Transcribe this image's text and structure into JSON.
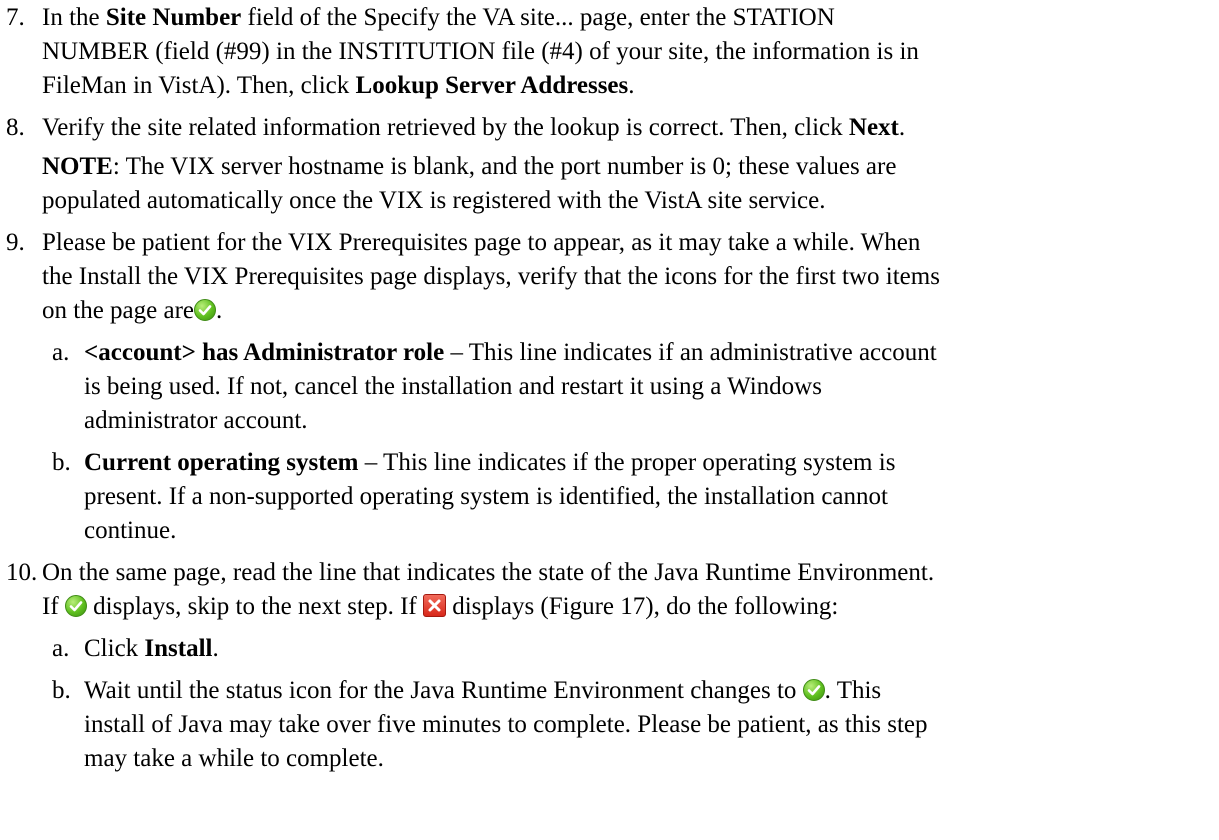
{
  "steps": {
    "s7": {
      "num": "7.",
      "l1_a": "In the ",
      "l1_b": "Site Number",
      "l1_c": " field of the Specify the VA site... page, enter the STATION",
      "l2": "NUMBER (field (#99) in the INSTITUTION file (#4) of your site, the information is in",
      "l3_a": "FileMan in VistA). Then, click ",
      "l3_b": "Lookup Server Addresses",
      "l3_c": "."
    },
    "s8": {
      "num": "8.",
      "l1_a": "Verify the site related information retrieved by the lookup is correct. Then, click ",
      "l1_b": "Next",
      "l1_c": ".",
      "note_label": "NOTE",
      "note_l1": ": The VIX server hostname is blank, and the port number is 0; these values are",
      "note_l2": "populated automatically once the VIX is registered with the VistA site service."
    },
    "s9": {
      "num": "9.",
      "l1": "Please be patient for the VIX Prerequisites page to appear, as it may take a while. When",
      "l2": "the Install the VIX Prerequisites page displays, verify that the icons for the first two items",
      "l3_a": "on the page are",
      "l3_b": ".",
      "a": {
        "letter": "a.",
        "bold": "<account> has Administrator role",
        "l1": " – This line indicates if an administrative account",
        "l2": "is being used. If not, cancel the installation and restart it using a Windows",
        "l3": "administrator account."
      },
      "b": {
        "letter": "b.",
        "bold": "Current operating system",
        "l1": " – This line indicates if the proper operating system is",
        "l2": "present. If a non-supported operating system is identified, the installation cannot",
        "l3": "continue."
      }
    },
    "s10": {
      "num": "10.",
      "l1": "On the same page, read the line that indicates the state of the Java Runtime Environment.",
      "l2_a": "If ",
      "l2_b": " displays, skip to the next step. If ",
      "l2_c": " displays (Figure 17), do the following:",
      "a": {
        "letter": "a.",
        "text": "Click ",
        "bold": "Install",
        "end": "."
      },
      "b": {
        "letter": "b.",
        "l1_a": "Wait until the status icon for the Java Runtime Environment changes to ",
        "l1_b": ". This",
        "l2": "install of Java may take over five minutes to complete. Please be patient, as this step",
        "l3": "may take a while to complete."
      }
    }
  },
  "icons": {
    "success": "green-check-icon",
    "error": "red-x-icon",
    "success_color": "#5fbf1f",
    "error_color": "#d8281a"
  }
}
